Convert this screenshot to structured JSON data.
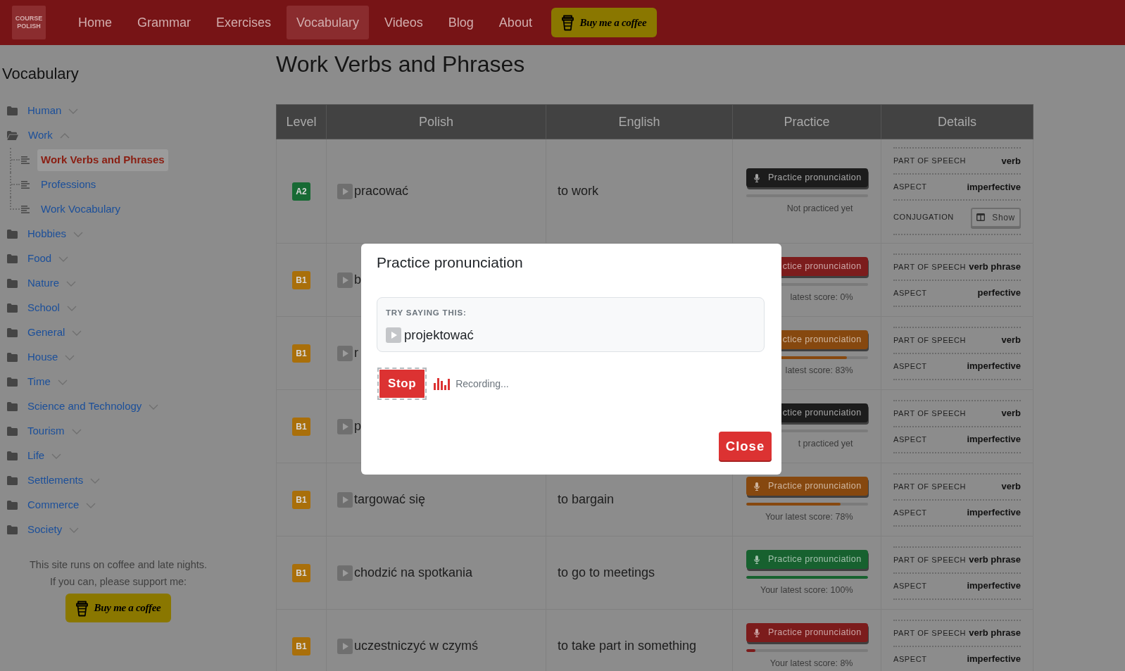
{
  "nav": {
    "logo": [
      "COURSE",
      "POLISH"
    ],
    "items": [
      {
        "label": "Home",
        "selected": false
      },
      {
        "label": "Grammar",
        "selected": false
      },
      {
        "label": "Exercises",
        "selected": false
      },
      {
        "label": "Vocabulary",
        "selected": true
      },
      {
        "label": "Videos",
        "selected": false
      },
      {
        "label": "Blog",
        "selected": false
      },
      {
        "label": "About",
        "selected": false
      }
    ],
    "coffee_button": "Buy me a coffee"
  },
  "sidebar": {
    "title": "Vocabulary",
    "items": [
      {
        "label": "Human",
        "expanded": false
      },
      {
        "label": "Work",
        "expanded": true,
        "children": [
          {
            "label": "Work Verbs and Phrases",
            "selected": true
          },
          {
            "label": "Professions",
            "selected": false
          },
          {
            "label": "Work Vocabulary",
            "selected": false
          }
        ]
      },
      {
        "label": "Hobbies",
        "expanded": false
      },
      {
        "label": "Food",
        "expanded": false
      },
      {
        "label": "Nature",
        "expanded": false
      },
      {
        "label": "School",
        "expanded": false
      },
      {
        "label": "General",
        "expanded": false
      },
      {
        "label": "House",
        "expanded": false
      },
      {
        "label": "Time",
        "expanded": false
      },
      {
        "label": "Science and Technology",
        "expanded": false
      },
      {
        "label": "Tourism",
        "expanded": false
      },
      {
        "label": "Life",
        "expanded": false
      },
      {
        "label": "Settlements",
        "expanded": false
      },
      {
        "label": "Commerce",
        "expanded": false
      },
      {
        "label": "Society",
        "expanded": false
      }
    ],
    "support_text": [
      "This site runs on coffee and late nights.",
      "If you can, please support me:"
    ],
    "coffee_button": "Buy me a coffee"
  },
  "page_title": "Work Verbs and Phrases",
  "table": {
    "columns": [
      "Level",
      "Polish",
      "English",
      "Practice",
      "Details"
    ],
    "rows": [
      {
        "level": {
          "text": "A2",
          "color": "#176a34"
        },
        "polish": "pracować",
        "english": "to work",
        "practice": {
          "kind": "with_icon",
          "label": "Practice pronunciation",
          "color": "#1c1c1c",
          "score": "Not practiced yet"
        },
        "details": [
          {
            "kind": "text",
            "label": "PART OF SPEECH",
            "value": "verb"
          },
          {
            "kind": "text",
            "label": "ASPECT",
            "value": "imperfective"
          },
          {
            "kind": "button",
            "label": "CONJUGATION",
            "value": "Show"
          }
        ]
      },
      {
        "level": {
          "text": "B1",
          "color": "#a96f0a"
        },
        "polish": "b",
        "practice": {
          "kind": "text_only",
          "label": "ctice pronunciation",
          "color": "#7c1c1c",
          "score": "latest score: 0%"
        },
        "details": [
          {
            "kind": "text",
            "label": "PART OF SPEECH",
            "value": "verb phrase"
          },
          {
            "kind": "text",
            "label": "ASPECT",
            "value": "perfective"
          }
        ]
      },
      {
        "level": {
          "text": "B1",
          "color": "#a96f0a"
        },
        "polish": "r",
        "practice": {
          "kind": "text_only",
          "label": "ctice pronunciation",
          "color": "#86480f",
          "level": 0.83,
          "score": "latest score: 83%"
        },
        "details": [
          {
            "kind": "text",
            "label": "PART OF SPEECH",
            "value": "verb"
          },
          {
            "kind": "text",
            "label": "ASPECT",
            "value": "imperfective"
          }
        ]
      },
      {
        "level": {
          "text": "B1",
          "color": "#a96f0a"
        },
        "polish": "p",
        "practice": {
          "kind": "text_only",
          "label": "ctice pronunciation",
          "color": "#1c1c1c",
          "score": "t practiced yet"
        },
        "details": [
          {
            "kind": "text",
            "label": "PART OF SPEECH",
            "value": "verb"
          },
          {
            "kind": "text",
            "label": "ASPECT",
            "value": "imperfective"
          }
        ]
      },
      {
        "level": {
          "text": "B1",
          "color": "#a96f0a"
        },
        "polish": "targować się",
        "english": "to bargain",
        "practice": {
          "kind": "with_icon",
          "label": "Practice pronunciation",
          "color": "#86480f",
          "level": 0.78,
          "score": "Your latest score: 78%"
        },
        "details": [
          {
            "kind": "text",
            "label": "PART OF SPEECH",
            "value": "verb"
          },
          {
            "kind": "text",
            "label": "ASPECT",
            "value": "imperfective"
          }
        ]
      },
      {
        "level": {
          "text": "B1",
          "color": "#a96f0a"
        },
        "polish": "chodzić na spotkania",
        "english": "to go to meetings",
        "practice": {
          "kind": "with_icon",
          "label": "Practice pronunciation",
          "color": "#17612f",
          "level": 1,
          "score": "Your latest score: 100%"
        },
        "details": [
          {
            "kind": "text",
            "label": "PART OF SPEECH",
            "value": "verb phrase"
          },
          {
            "kind": "text",
            "label": "ASPECT",
            "value": "imperfective"
          }
        ]
      },
      {
        "level": {
          "text": "B1",
          "color": "#a96f0a"
        },
        "polish": "uczestniczyć w czymś",
        "english": "to take part in something",
        "practice": {
          "kind": "with_icon",
          "label": "Practice pronunciation",
          "color": "#7c1c1c",
          "level": 0.08,
          "score": "Your latest score: 8%"
        },
        "details": [
          {
            "kind": "text",
            "label": "PART OF SPEECH",
            "value": "verb phrase"
          },
          {
            "kind": "text",
            "label": "ASPECT",
            "value": "imperfective"
          }
        ]
      }
    ]
  },
  "modal": {
    "title": "Practice pronunciation",
    "prompt_label": "TRY SAYING THIS:",
    "phrase": "projektować",
    "stop_button": {
      "label": "Stop",
      "focused": true
    },
    "status": "Recording...",
    "close_button": "Close"
  }
}
